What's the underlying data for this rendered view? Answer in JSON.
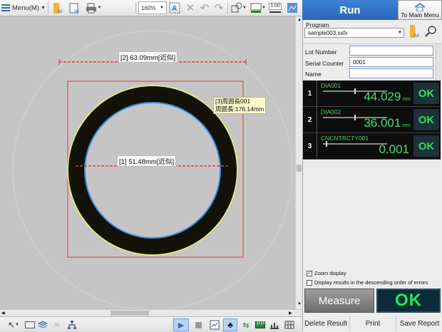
{
  "toolbar": {
    "menu_label": "Menu(M)",
    "zoom_value": "160%",
    "line_width_value": "1.00"
  },
  "canvas": {
    "dim2_label": "[2] 63.09mm[近似]",
    "dim1_label": "[1] 51.48mm[近似]",
    "dim3_label_line1": "[3]周囲長001",
    "dim3_label_line2": "周囲長:176.14mm"
  },
  "panel": {
    "run_label": "Run",
    "main_menu_label": "To Main Menu",
    "program_label": "Program",
    "program_value": "sample003.ssfx",
    "lot_number_label": "Lot Number",
    "lot_number_value": "",
    "serial_counter_label": "Serial Counter",
    "serial_counter_value": "0001",
    "name_label": "Name",
    "name_value": ""
  },
  "results": [
    {
      "index": "1",
      "name": "DIA001",
      "value": "44.029",
      "unit": "mm",
      "status": "OK"
    },
    {
      "index": "2",
      "name": "DIA002",
      "value": "36.001",
      "unit": "mm",
      "status": "OK"
    },
    {
      "index": "3",
      "name": "CNCNTRCTY001",
      "value": "0.001",
      "unit": "",
      "status": "OK"
    }
  ],
  "options": {
    "zoom_display_label": "Zoom display",
    "zoom_display_checked": true,
    "descending_errors_label": "Display results in the descending order of errors",
    "descending_errors_checked": false
  },
  "actions": {
    "measure_label": "Measure",
    "overall_status": "OK",
    "delete_result_label": "Delete Result",
    "print_label": "Print",
    "save_report_label": "Save Report"
  },
  "colors": {
    "run_header": "#2f6fc4",
    "ok_green": "#27e35a",
    "measure_line": "#e03a3a",
    "edge_blue": "#3a8ee6",
    "edge_yellow": "#e8f06a"
  }
}
